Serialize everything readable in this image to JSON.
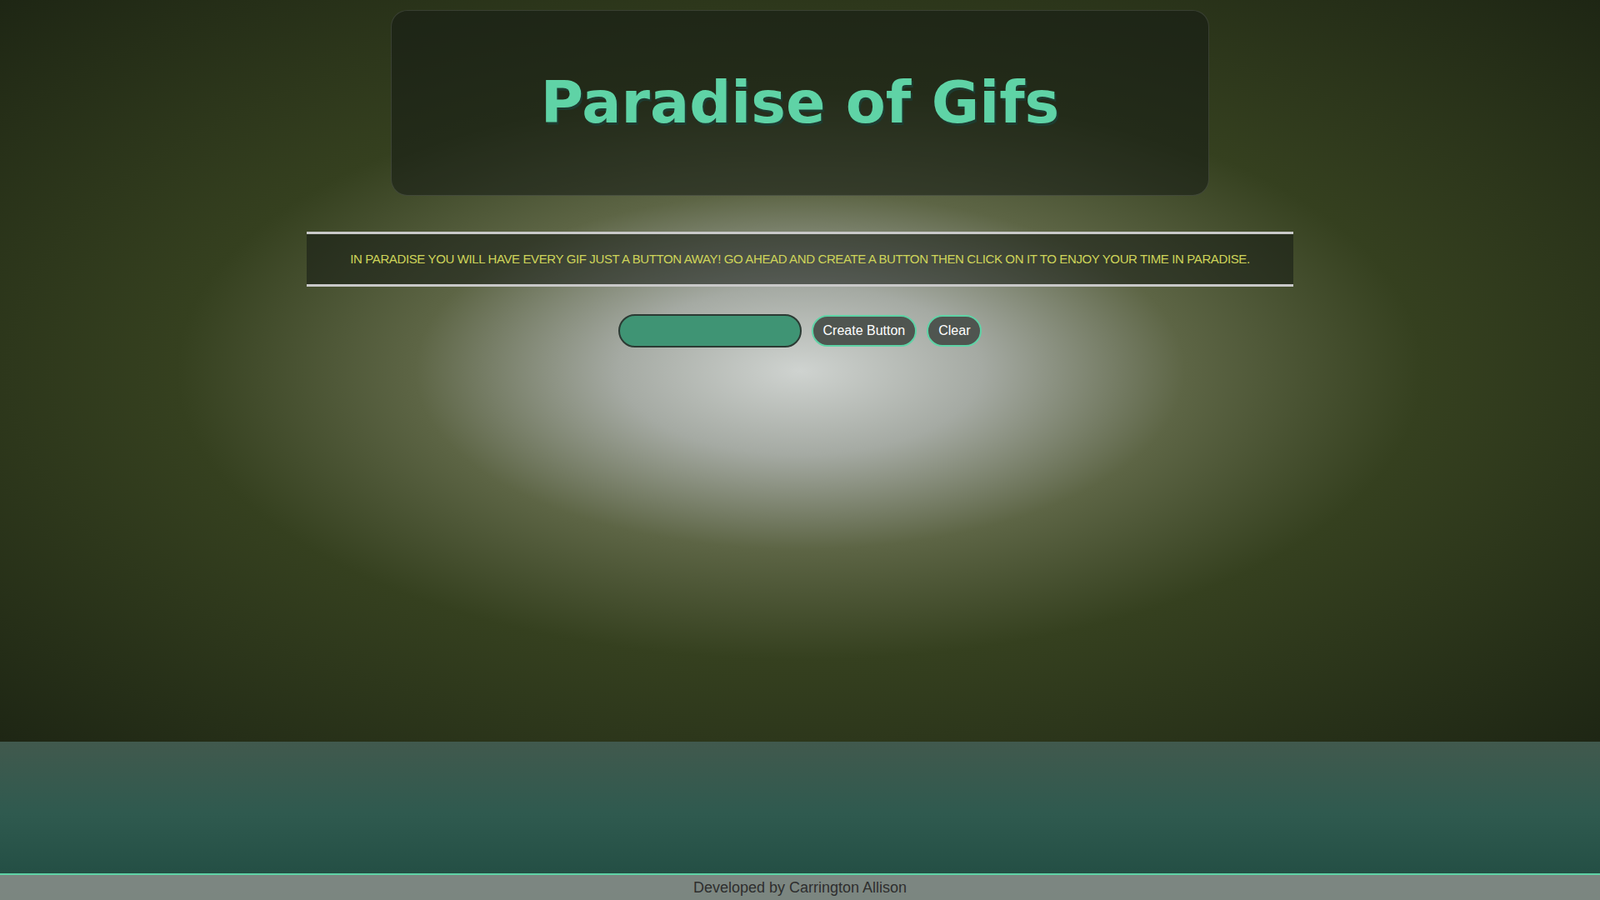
{
  "header": {
    "title": "Paradise of Gifs"
  },
  "tagline": "IN PARADISE YOU WILL HAVE EVERY GIF JUST A BUTTON AWAY! GO AHEAD AND CREATE A BUTTON THEN CLICK ON IT TO ENJOY YOUR TIME IN PARADISE.",
  "form": {
    "input_value": "",
    "buttons": [
      "Create Button",
      "Clear"
    ]
  },
  "footer": {
    "text": "Developed by Carrington Allison"
  }
}
